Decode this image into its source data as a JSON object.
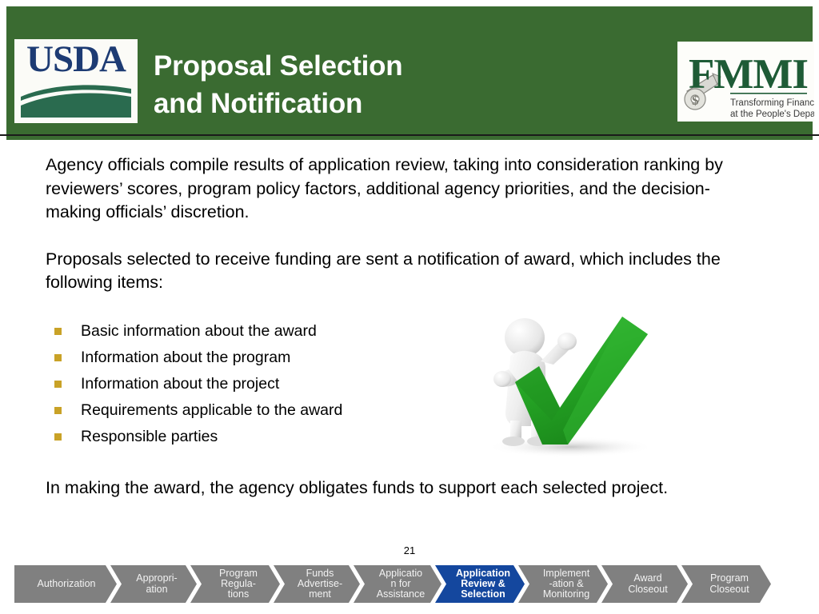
{
  "theme": {
    "header_green": "#3A6B31",
    "bullet_gold": "#C9A227",
    "chevron_gray": "#808080",
    "chevron_active_blue": "#14479E",
    "usda_navy": "#1D3B73",
    "check_green": "#2DA22D"
  },
  "header": {
    "title_line1": "Proposal Selection",
    "title_line2": "and Notification",
    "usda_logo": {
      "wordmark": "USDA",
      "alt": "usda-logo"
    },
    "fmmi_logo": {
      "wordmark": "FMMI",
      "tagline_line1": "Transforming Financials",
      "tagline_line2": "at the People's Department"
    }
  },
  "body": {
    "paragraph1": "Agency officials compile results of application review, taking into consideration ranking by reviewers’ scores, program policy factors, additional agency priorities, and the decision-making officials’ discretion.",
    "paragraph2": "Proposals selected to receive funding are sent a notification of award, which includes the following items:",
    "bullets": [
      "Basic information about the award",
      "Information about the program",
      "Information about the project",
      "Requirements applicable to the award",
      "Responsible parties"
    ],
    "paragraph3": "In making the award, the agency obligates funds to support each selected project."
  },
  "illustration": {
    "name": "figure-with-green-checkmark"
  },
  "footer": {
    "page_number": "21"
  },
  "process_bar": {
    "active_index": 5,
    "steps": [
      {
        "label": "Authorization",
        "active": false
      },
      {
        "label": "Appropri-\nation",
        "active": false
      },
      {
        "label": "Program\nRegula-\ntions",
        "active": false
      },
      {
        "label": "Funds\nAdvertise-\nment",
        "active": false
      },
      {
        "label": "Applicatio\nn for\nAssistance",
        "active": false
      },
      {
        "label": "Application\nReview &\nSelection",
        "active": true
      },
      {
        "label": "Implement\n-ation &\nMonitoring",
        "active": false
      },
      {
        "label": "Award\nCloseout",
        "active": false
      },
      {
        "label": "Program\nCloseout",
        "active": false
      }
    ]
  }
}
